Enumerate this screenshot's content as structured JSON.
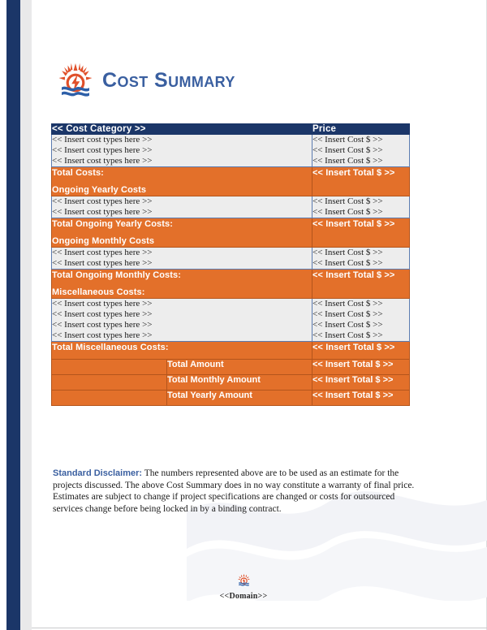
{
  "document": {
    "title": "Cost Summary",
    "logo_icon": "sun-wave-bolt-logo"
  },
  "table": {
    "headers": {
      "category": "<< Cost Category >>",
      "price": "Price"
    },
    "placeholders": {
      "cost_type": "<< Insert cost types here >>",
      "cost_amount": "<< Insert Cost $ >>",
      "total_amount": "<< Insert Total $ >>"
    },
    "sections": [
      {
        "kind": "detail",
        "rows": [
          {
            "category": "<< Insert cost types here >>",
            "price": "<< Insert Cost $ >>"
          },
          {
            "category": "<< Insert cost types here >>",
            "price": "<< Insert Cost $ >>"
          },
          {
            "category": "<< Insert cost types here >>",
            "price": "<< Insert Cost $ >>"
          }
        ]
      },
      {
        "kind": "total",
        "label": "Total Costs:",
        "sublabel": "Ongoing Yearly Costs",
        "price": "<< Insert Total $ >>"
      },
      {
        "kind": "detail",
        "rows": [
          {
            "category": "<< Insert cost types here >>",
            "price": "<< Insert Cost $ >>"
          },
          {
            "category": "<< Insert cost types here >>",
            "price": "<< Insert Cost $ >>"
          }
        ]
      },
      {
        "kind": "total",
        "label": "Total Ongoing Yearly Costs:",
        "sublabel": "Ongoing Monthly Costs",
        "price": "<< Insert Total $ >>"
      },
      {
        "kind": "detail",
        "rows": [
          {
            "category": "<< Insert cost types here >>",
            "price": "<< Insert Cost $ >>"
          },
          {
            "category": "<< Insert cost types here >>",
            "price": "<< Insert Cost $ >>"
          }
        ]
      },
      {
        "kind": "total",
        "label": "Total Ongoing Monthly Costs:",
        "sublabel": "Miscellaneous Costs:",
        "price": "<< Insert Total $ >>"
      },
      {
        "kind": "detail",
        "rows": [
          {
            "category": "<< Insert cost types here >>",
            "price": "<< Insert Cost $ >>"
          },
          {
            "category": "<< Insert cost types here >>",
            "price": "<< Insert Cost $ >>"
          },
          {
            "category": "<< Insert cost types here >>",
            "price": "<< Insert Cost $ >>"
          },
          {
            "category": "<< Insert cost types here >>",
            "price": "<< Insert Cost $ >>"
          }
        ]
      },
      {
        "kind": "total",
        "label": "Total Miscellaneous Costs:",
        "sublabel": "",
        "price": "<< Insert Total $ >>"
      }
    ],
    "summary_rows": [
      {
        "label": "Total Amount",
        "price": "<< Insert Total $ >>"
      },
      {
        "label": "Total Monthly Amount",
        "price": "<< Insert Total $ >>"
      },
      {
        "label": "Total Yearly Amount",
        "price": "<< Insert Total $ >>"
      }
    ]
  },
  "disclaimer": {
    "label": "Standard Disclaimer:",
    "body": " The numbers represented above are to be used as an estimate for the projects discussed. The above Cost Summary does in no way constitute a warranty of final price.  Estimates are subject to change if project specifications are changed or costs for outsourced services change before being locked in by a binding contract."
  },
  "footer": {
    "text": "<<Domain>>",
    "logo_icon": "sun-wave-bolt-logo"
  },
  "colors": {
    "header_blue": "#1B3668",
    "accent_orange": "#E3702A",
    "title_blue": "#3A5FA0",
    "detail_gray": "#EDEDED",
    "border_blue": "#5B7BB0",
    "border_orange": "#B4551C"
  }
}
